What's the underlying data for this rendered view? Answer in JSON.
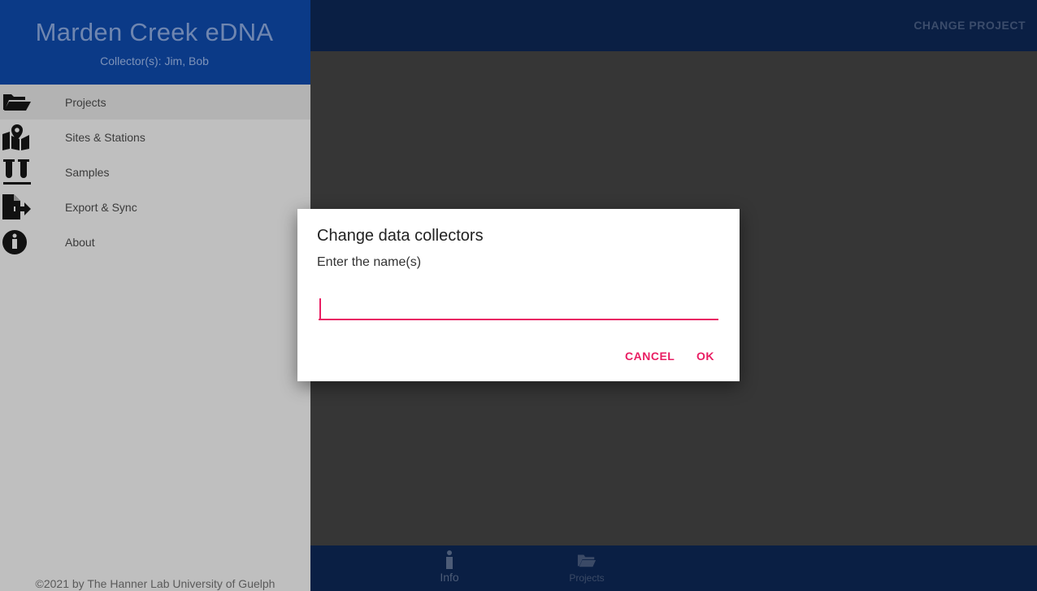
{
  "appbar": {
    "action_label": "CHANGE PROJECT"
  },
  "drawer": {
    "title": "Marden Creek eDNA",
    "subtitle": "Collector(s): Jim, Bob",
    "items": [
      {
        "label": "Projects",
        "icon": "folder-open-icon",
        "selected": true
      },
      {
        "label": "Sites & Stations",
        "icon": "map-marker-icon"
      },
      {
        "label": "Samples",
        "icon": "test-tubes-icon"
      },
      {
        "label": "Export & Sync",
        "icon": "file-export-icon"
      },
      {
        "label": "About",
        "icon": "info-circle-icon"
      }
    ],
    "footer": "©2021 by The Hanner Lab University of Guelph"
  },
  "bottom_nav": {
    "items": [
      {
        "label": "Info",
        "icon": "info-icon"
      },
      {
        "label": "Projects",
        "icon": "folder-icon"
      }
    ]
  },
  "dialog": {
    "title": "Change data collectors",
    "message": "Enter the name(s)",
    "input_value": "",
    "cancel_label": "CANCEL",
    "ok_label": "OK"
  },
  "colors": {
    "accent": "#e91e63",
    "drawer_header": "#0b3a87",
    "appbar": "#0a1f44"
  }
}
